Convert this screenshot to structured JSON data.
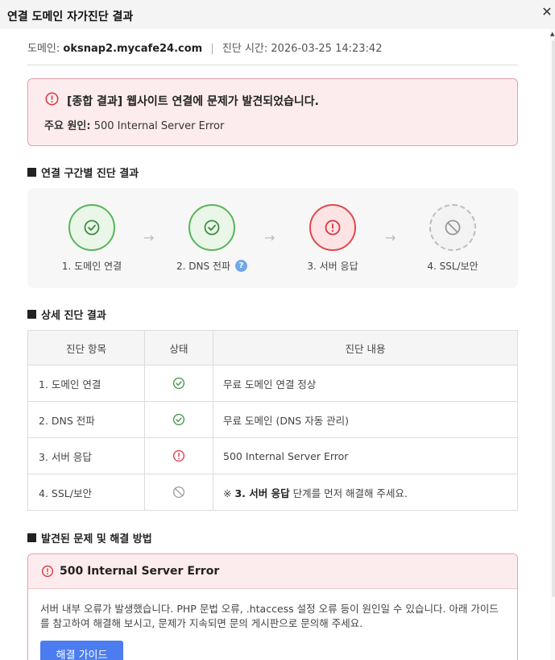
{
  "window": {
    "title": "연결 도메인 자가진단 결과",
    "close_label": "✕"
  },
  "meta": {
    "domain_label": "도메인:",
    "domain_value": "oksnap2.mycafe24.com",
    "separator": "|",
    "time_label": "진단 시간:",
    "time_value": "2026-03-25 14:23:42"
  },
  "summary": {
    "title": "[종합 결과] 웹사이트 연결에 문제가 발견되었습니다.",
    "cause_label": "주요 원인:",
    "cause_value": "500 Internal Server Error"
  },
  "sections": {
    "steps_title": "연결 구간별 진단 결과",
    "detail_title": "상세 진단 결과",
    "problem_title": "발견된 문제 및 해결 방법"
  },
  "steps": [
    {
      "label": "1. 도메인 연결",
      "status": "ok"
    },
    {
      "label": "2. DNS 전파",
      "status": "ok",
      "help": "?"
    },
    {
      "label": "3. 서버 응답",
      "status": "error"
    },
    {
      "label": "4. SSL/보안",
      "status": "skipped"
    }
  ],
  "arrow_glyph": "→",
  "table": {
    "headers": [
      "진단 항목",
      "상태",
      "진단 내용"
    ],
    "rows": [
      {
        "item": "1. 도메인 연결",
        "status": "ok",
        "desc": "무료 도메인 연결 정상"
      },
      {
        "item": "2. DNS 전파",
        "status": "ok",
        "desc": "무료 도메인 (DNS 자동 관리)"
      },
      {
        "item": "3. 서버 응답",
        "status": "error",
        "desc": "500 Internal Server Error"
      },
      {
        "item": "4. SSL/보안",
        "status": "skipped",
        "desc_prefix": "※",
        "desc_bold": "3. 서버 응답",
        "desc_suffix": "단계를 먼저 해결해 주세요."
      }
    ]
  },
  "problem": {
    "title": "500 Internal Server Error",
    "body": "서버 내부 오류가 발생했습니다. PHP 문법 오류, .htaccess 설정 오류 등이 원인일 수 있습니다. 아래 가이드를 참고하여 해결해 보시고, 문제가 지속되면 문의 게시판으로 문의해 주세요.",
    "button_label": "해결 가이드"
  },
  "colors": {
    "ok": "#4caf50",
    "error": "#d9363e",
    "skipped": "#999999",
    "accent": "#4b7df0"
  }
}
